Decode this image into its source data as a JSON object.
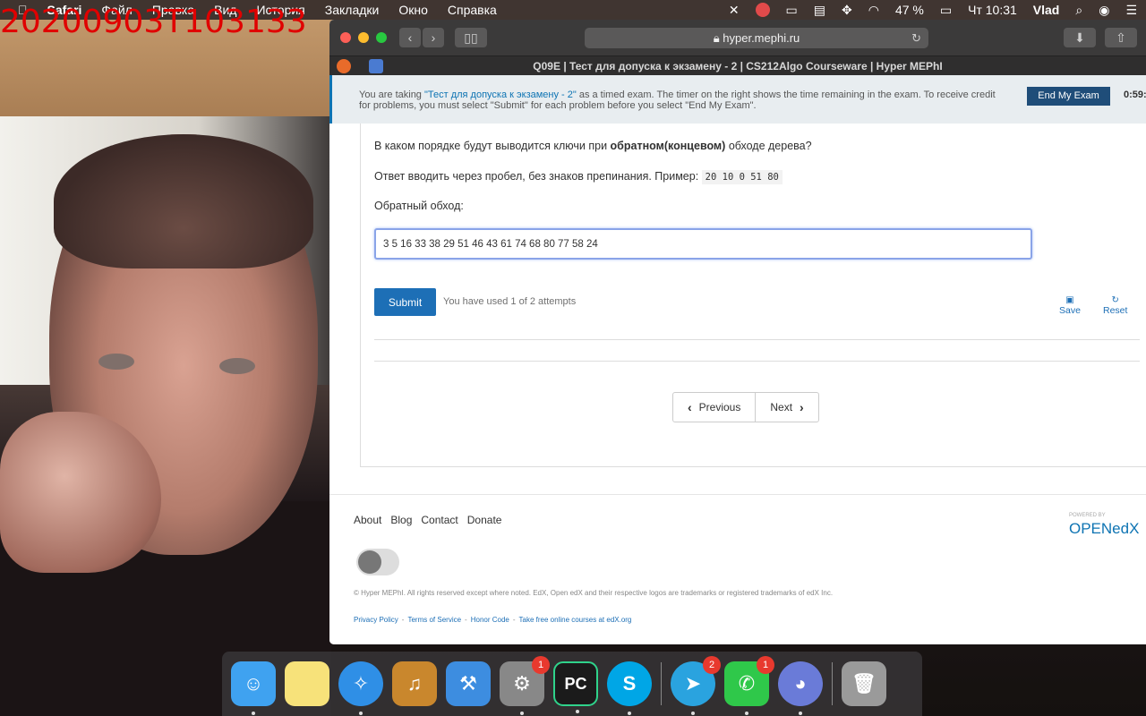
{
  "timestamp": "20200903T103133",
  "menubar": {
    "app": "Safari",
    "items": [
      "Файл",
      "Правка",
      "Вид",
      "История",
      "Закладки",
      "Окно",
      "Справка"
    ],
    "battery": "47 %",
    "datetime": "Чт 10:31",
    "user": "Vlad"
  },
  "browser": {
    "url": "hyper.mephi.ru",
    "tab_title": "Q09E | Тест для допуска к экзамену - 2 | CS212Algo Courseware | Hyper MEPhI"
  },
  "banner": {
    "msg_pre": "You are taking ",
    "exam_link": "\"Тест для допуска к экзамену - 2\"",
    "msg_post": " as a timed exam. The timer on the right shows the time remaining in the exam. To receive credit for problems, you must select \"Submit\" for each problem before you select \"End My Exam\".",
    "end_button": "End My Exam",
    "timer": "0:59:"
  },
  "problem": {
    "question_pre": "В каком порядке будут выводится ключи при ",
    "question_bold": "обратном(концевом)",
    "question_post": " обходе дерева?",
    "format_text": "Ответ вводить через пробел, без знаков препинания. Пример: ",
    "example": "20 10 0 51 80",
    "input_label": "Обратный обход:",
    "answer_value": "3 5 16 33 38 29 51 46 43 61 74 68 80 77 58 24",
    "submit_label": "Submit",
    "attempts_text": "You have used 1 of 2 attempts",
    "save_label": "Save",
    "reset_label": "Reset"
  },
  "pager": {
    "previous": "Previous",
    "next": "Next"
  },
  "footer": {
    "links": [
      "About",
      "Blog",
      "Contact",
      "Donate"
    ],
    "copyright": "© Hyper MEPhI. All rights reserved except where noted. EdX, Open edX and their respective logos are trademarks or registered trademarks of edX Inc.",
    "legal": [
      "Privacy Policy",
      "Terms of Service",
      "Honor Code",
      "Take free online courses at edX.org"
    ],
    "powered_by": "POWERED BY",
    "logo_text": "OPENedX"
  },
  "dock": {
    "items": [
      {
        "name": "finder",
        "color": "#3fa2f0",
        "badge": ""
      },
      {
        "name": "notes",
        "color": "#f7e27a",
        "badge": ""
      },
      {
        "name": "safari",
        "color": "#2f8fe6",
        "badge": ""
      },
      {
        "name": "garageband",
        "color": "#c9872d",
        "badge": ""
      },
      {
        "name": "xcode",
        "color": "#3d8de0",
        "badge": ""
      },
      {
        "name": "system-preferences",
        "color": "#888888",
        "badge": "1"
      },
      {
        "name": "pycharm",
        "color": "#1b1b1b",
        "badge": ""
      },
      {
        "name": "skype",
        "color": "#00a6e6",
        "badge": ""
      },
      {
        "name": "telegram",
        "color": "#2aa3df",
        "badge": "2"
      },
      {
        "name": "facetime",
        "color": "#2fc84a",
        "badge": "1"
      },
      {
        "name": "discord",
        "color": "#6a7bd8",
        "badge": ""
      },
      {
        "name": "trash",
        "color": "#9a9a9a",
        "badge": ""
      }
    ],
    "pycharm_label": "PC"
  }
}
